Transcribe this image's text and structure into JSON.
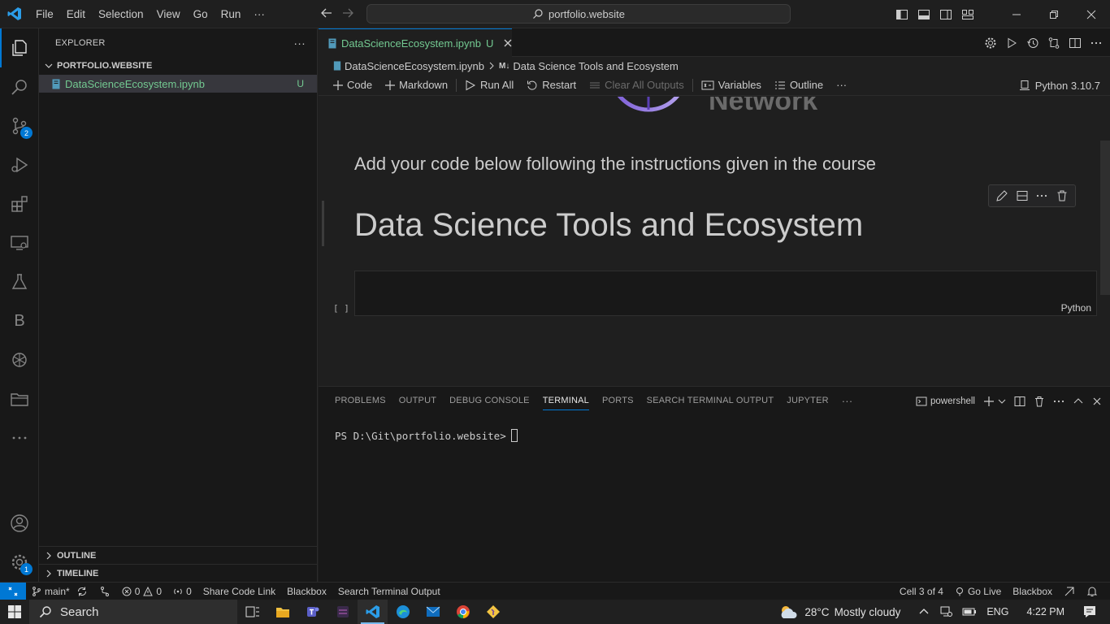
{
  "titlebar": {
    "menu": [
      "File",
      "Edit",
      "Selection",
      "View",
      "Go",
      "Run",
      "···"
    ],
    "command_center": "portfolio.website"
  },
  "activity_bar": {
    "source_control_badge": "2",
    "accounts_badge": "1",
    "blackbox_letter": "B"
  },
  "sidebar": {
    "title": "EXPLORER",
    "more": "···",
    "folder": "PORTFOLIO.WEBSITE",
    "file": "DataScienceEcosystem.ipynb",
    "file_status": "U",
    "outline": "OUTLINE",
    "timeline": "TIMELINE"
  },
  "editor": {
    "tab_label": "DataScienceEcosystem.ipynb",
    "tab_status": "U",
    "breadcrumb_file": "DataScienceEcosystem.ipynb",
    "breadcrumb_md_prefix": "M↓",
    "breadcrumb_section": "Data Science Tools and Ecosystem",
    "toolbar": {
      "code": "Code",
      "markdown": "Markdown",
      "run_all": "Run All",
      "restart": "Restart",
      "clear_outputs": "Clear All Outputs",
      "variables": "Variables",
      "outline": "Outline",
      "more": "···",
      "kernel": "Python 3.10.7"
    },
    "logo_text": "Network",
    "markdown_text": "Add your code below following the instructions given in the course",
    "heading": "Data Science Tools and Ecosystem",
    "code_cell_lang": "Python",
    "exec_count": "[ ]"
  },
  "panel": {
    "tabs": [
      "PROBLEMS",
      "OUTPUT",
      "DEBUG CONSOLE",
      "TERMINAL",
      "PORTS",
      "SEARCH TERMINAL OUTPUT",
      "JUPYTER"
    ],
    "more": "···",
    "shell": "powershell",
    "prompt": "PS D:\\Git\\portfolio.website>"
  },
  "statusbar": {
    "branch": "main*",
    "errors": "0",
    "warnings": "0",
    "ports": "0",
    "share": "Share Code Link",
    "blackbox": "Blackbox",
    "search_terminal": "Search Terminal Output",
    "cell": "Cell 3 of 4",
    "go_live": "Go Live",
    "blackbox_right": "Blackbox"
  },
  "taskbar": {
    "search": "Search",
    "weather_temp": "28°C",
    "weather_desc": "Mostly cloudy",
    "lang": "ENG",
    "time": "4:22 PM"
  },
  "colors": {
    "accent": "#0078d4",
    "untracked": "#73c991",
    "background": "#1f1f1f"
  }
}
